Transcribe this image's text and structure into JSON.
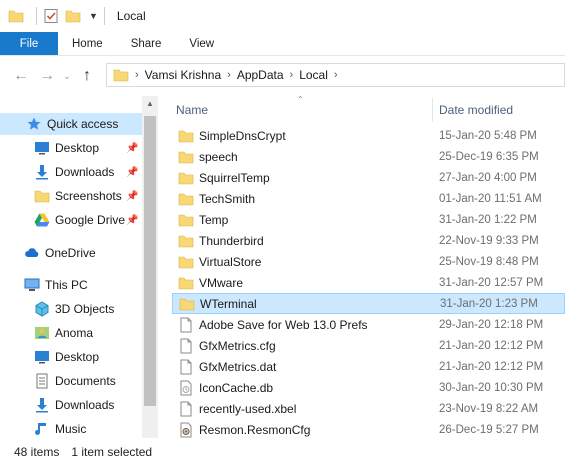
{
  "titlebar": {
    "title": "Local"
  },
  "ribbon": {
    "tabs": [
      "File",
      "Home",
      "Share",
      "View"
    ]
  },
  "breadcrumb": [
    "Vamsi Krishna",
    "AppData",
    "Local"
  ],
  "nav": {
    "items": [
      {
        "label": "Quick access",
        "icon": "star-icon",
        "selected": true,
        "pinned": false
      },
      {
        "label": "Desktop",
        "icon": "desktop-icon",
        "pinned": true
      },
      {
        "label": "Downloads",
        "icon": "download-icon",
        "pinned": true
      },
      {
        "label": "Screenshots",
        "icon": "folder-icon",
        "pinned": true
      },
      {
        "label": "Google Drive",
        "icon": "google-drive-icon",
        "pinned": true
      },
      {
        "label": "OneDrive",
        "icon": "cloud-icon",
        "pinned": false
      },
      {
        "label": "This PC",
        "icon": "pc-icon",
        "pinned": false
      },
      {
        "label": "3D Objects",
        "icon": "cube-icon",
        "pinned": false
      },
      {
        "label": "Anoma",
        "icon": "user-folder-icon",
        "pinned": false
      },
      {
        "label": "Desktop",
        "icon": "desktop-icon",
        "pinned": false
      },
      {
        "label": "Documents",
        "icon": "documents-icon",
        "pinned": false
      },
      {
        "label": "Downloads",
        "icon": "download-icon",
        "pinned": false
      },
      {
        "label": "Music",
        "icon": "music-icon",
        "pinned": false
      }
    ]
  },
  "columns": {
    "name": "Name",
    "date": "Date modified"
  },
  "files": [
    {
      "name": "SimpleDnsCrypt",
      "date": "15-Jan-20 5:48 PM",
      "type": "folder"
    },
    {
      "name": "speech",
      "date": "25-Dec-19 6:35 PM",
      "type": "folder"
    },
    {
      "name": "SquirrelTemp",
      "date": "27-Jan-20 4:00 PM",
      "type": "folder"
    },
    {
      "name": "TechSmith",
      "date": "01-Jan-20 11:51 AM",
      "type": "folder"
    },
    {
      "name": "Temp",
      "date": "31-Jan-20 1:22 PM",
      "type": "folder"
    },
    {
      "name": "Thunderbird",
      "date": "22-Nov-19 9:33 PM",
      "type": "folder"
    },
    {
      "name": "VirtualStore",
      "date": "25-Nov-19 8:48 PM",
      "type": "folder"
    },
    {
      "name": "VMware",
      "date": "31-Jan-20 12:57 PM",
      "type": "folder"
    },
    {
      "name": "WTerminal",
      "date": "31-Jan-20 1:23 PM",
      "type": "folder",
      "selected": true
    },
    {
      "name": "Adobe Save for Web 13.0 Prefs",
      "date": "29-Jan-20 12:18 PM",
      "type": "file"
    },
    {
      "name": "GfxMetrics.cfg",
      "date": "21-Jan-20 12:12 PM",
      "type": "file"
    },
    {
      "name": "GfxMetrics.dat",
      "date": "21-Jan-20 12:12 PM",
      "type": "file"
    },
    {
      "name": "IconCache.db",
      "date": "30-Jan-20 10:30 PM",
      "type": "db"
    },
    {
      "name": "recently-used.xbel",
      "date": "23-Nov-19 8:22 AM",
      "type": "file"
    },
    {
      "name": "Resmon.ResmonCfg",
      "date": "26-Dec-19 5:27 PM",
      "type": "cfg"
    }
  ],
  "status": {
    "count": "48 items",
    "selection": "1 item selected"
  },
  "colors": {
    "accent": "#1979ca",
    "selection": "#cce8ff",
    "folder": "#f8d775"
  }
}
